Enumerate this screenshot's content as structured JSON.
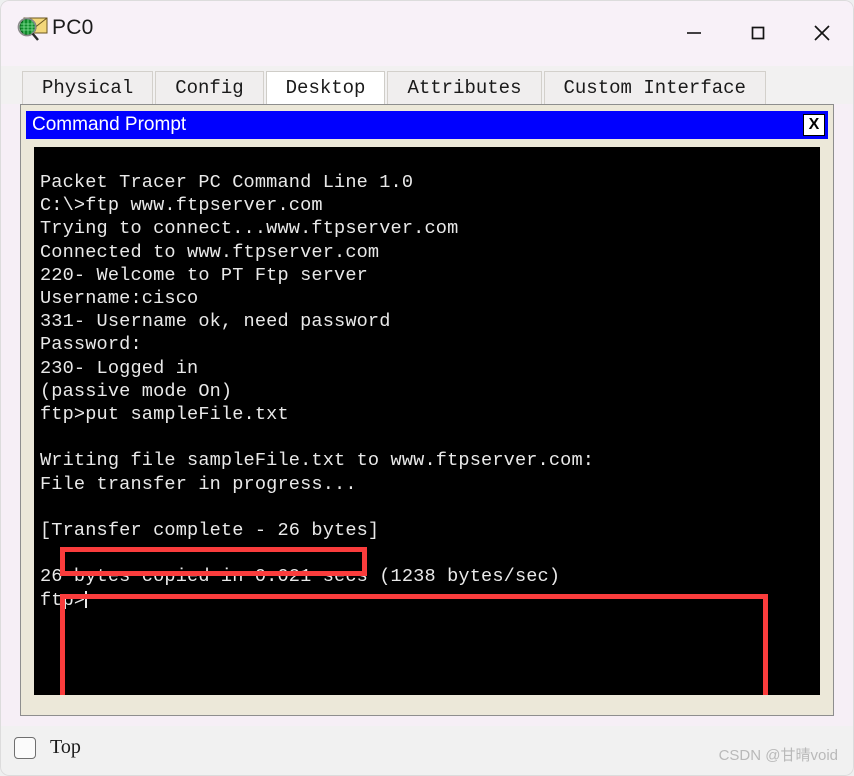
{
  "window": {
    "title": "PC0",
    "icon": "packet-tracer-pc-icon",
    "bg_color": "#f8f1f8",
    "controls": {
      "minimize": "—",
      "maximize": "☐",
      "close": "✕"
    }
  },
  "tabs": [
    {
      "label": "Physical",
      "active": false
    },
    {
      "label": "Config",
      "active": false
    },
    {
      "label": "Desktop",
      "active": true
    },
    {
      "label": "Attributes",
      "active": false
    },
    {
      "label": "Custom Interface",
      "active": false
    }
  ],
  "command_prompt": {
    "title": "Command Prompt",
    "titlebar_color": "#0000ff",
    "close_label": "X",
    "terminal_bg": "#000000",
    "terminal_fg": "#e9e9e9",
    "lines": [
      "Packet Tracer PC Command Line 1.0",
      "C:\\>ftp www.ftpserver.com",
      "Trying to connect...www.ftpserver.com",
      "Connected to www.ftpserver.com",
      "220- Welcome to PT Ftp server",
      "Username:cisco",
      "331- Username ok, need password",
      "Password:",
      "230- Logged in",
      "(passive mode On)",
      "ftp>put sampleFile.txt",
      "",
      "Writing file sampleFile.txt to www.ftpserver.com:",
      "File transfer in progress...",
      "",
      "[Transfer complete - 26 bytes]",
      "",
      "26 bytes copied in 0.021 secs (1238 bytes/sec)",
      "ftp>"
    ]
  },
  "annotations": {
    "color": "#fa3c3c",
    "boxes": [
      {
        "name": "put-command-highlight",
        "target_line": "ftp>put sampleFile.txt"
      },
      {
        "name": "transfer-result-highlight",
        "target_line": "26 bytes copied in 0.021 secs (1238 bytes/sec)"
      }
    ]
  },
  "statusbar": {
    "top_checkbox": {
      "label": "Top",
      "checked": false
    },
    "watermark": "CSDN @甘晴void"
  }
}
